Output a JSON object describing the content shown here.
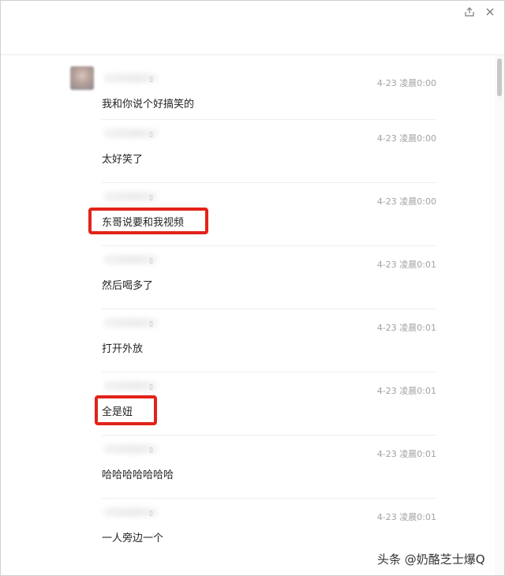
{
  "messages": [
    {
      "time": "4-23 凌晨0:00",
      "text": "我和你说个好搞笑的"
    },
    {
      "time": "4-23 凌晨0:00",
      "text": "太好笑了"
    },
    {
      "time": "4-23 凌晨0:00",
      "text": "东哥说要和我视频"
    },
    {
      "time": "4-23 凌晨0:01",
      "text": "然后喝多了"
    },
    {
      "time": "4-23 凌晨0:01",
      "text": "打开外放"
    },
    {
      "time": "4-23 凌晨0:01",
      "text": "全是妞"
    },
    {
      "time": "4-23 凌晨0:01",
      "text": "哈哈哈哈哈哈哈"
    },
    {
      "time": "4-23 凌晨0:01",
      "text": "一人旁边一个"
    }
  ],
  "watermark": "头条 @奶酪芝士爆Q",
  "icons": {
    "share": "share-icon",
    "close": "close-icon",
    "device": "phone-icon"
  },
  "colors": {
    "highlight": "#e2231a",
    "time": "#a2a2a2",
    "text": "#222222"
  }
}
